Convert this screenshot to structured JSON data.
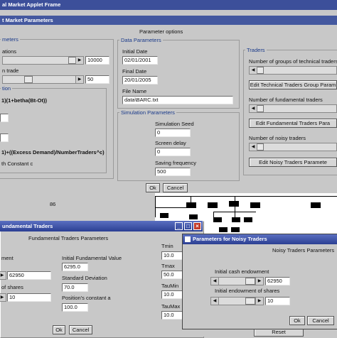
{
  "main_window": {
    "title": "al Market Applet Frame",
    "subtitle": "t Market Parameters",
    "header": "Parameter options"
  },
  "left": {
    "group_title": "meters",
    "row1_label": "ations",
    "row1_value": "10000",
    "row2_label": "n trade",
    "row2_value": "50",
    "sub_title": "tion",
    "formula1": "1)(1+betha(Bt-Ot))",
    "formula2": "1)+((Excess Demand)/NumberTraders^c)",
    "formula3": "th Constant c"
  },
  "data_params": {
    "title": "Data Parameters",
    "initial_date_label": "Initial Date",
    "initial_date": "02/01/2001",
    "final_date_label": "Final Date",
    "final_date": "20/01/2005",
    "file_name_label": "File Name",
    "file_name": "data\\BARC.txt"
  },
  "sim_params": {
    "title": "Simulation Parameters",
    "seed_label": "Simulation Seed",
    "seed": "0",
    "delay_label": "Screen delay",
    "delay": "0",
    "saving_label": "Saving frequency",
    "saving": "500"
  },
  "traders": {
    "title": "Traders",
    "tech_groups_label": "Number of groups of technical traders",
    "edit_tech_btn": "Edit Technical Traders Group Param",
    "fund_label": "Number of fundamental traders",
    "edit_fund_btn": "Edit Fundamental Traders Para",
    "noisy_label": "Number of noisy traders",
    "edit_noisy_btn": "Edit Noisy Traders Paramete"
  },
  "main_buttons": {
    "ok": "Ok",
    "cancel": "Cancel"
  },
  "tree_label": "86",
  "fundamental_dialog": {
    "title": "undamental Traders",
    "header": "Fundamental Traders Parameters",
    "ment_label": "ment",
    "ment_value": "62950",
    "shares_label": "of shares",
    "shares_value": "10",
    "ifv_label": "Initial Fundamental Value",
    "ifv": "6295.0",
    "std_label": "Standard Deviation",
    "std": "70.0",
    "pos_label": "Position's constant a",
    "pos": "100.0",
    "tmin_label": "Tmin",
    "tmin": "10.0",
    "tmax_label": "Tmax",
    "tmax": "50.0",
    "taumin_label": "TauMin",
    "taumin": "10.0",
    "taumax_label": "TauMax",
    "taumax": "10.0",
    "ok": "Ok",
    "cancel": "Cancel"
  },
  "noisy_dialog": {
    "title": "Parameters for Noisy Traders",
    "header": "Noisy Traders Parameters",
    "cash_label": "Initial cash endowment",
    "cash": "62950",
    "shares_label": "Initial endowment of shares",
    "shares": "10",
    "ok": "Ok",
    "cancel": "Cancel"
  },
  "bottom": {
    "reset": "Reset"
  },
  "colors": {
    "title_blue": "#3c4f9a",
    "bg": "#c8c8c8"
  }
}
